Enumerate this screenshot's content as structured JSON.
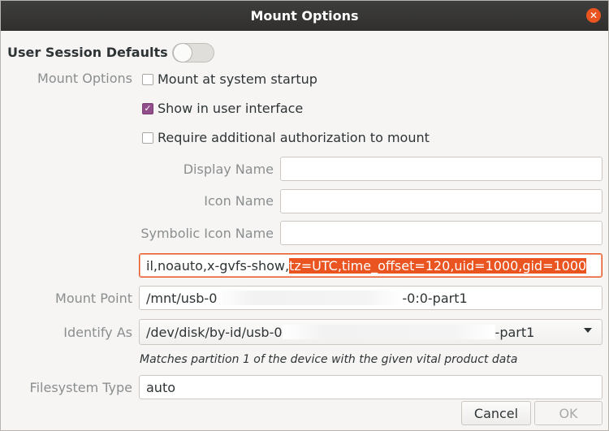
{
  "window": {
    "title": "Mount Options",
    "close_icon": "close-icon"
  },
  "section": {
    "title": "User Session Defaults",
    "toggle_on": false
  },
  "mount_options": {
    "label": "Mount Options",
    "checkboxes": [
      {
        "label": "Mount at system startup",
        "checked": false
      },
      {
        "label": "Show in user interface",
        "checked": true
      },
      {
        "label": "Require additional authorization to mount",
        "checked": false
      }
    ]
  },
  "fields": {
    "display_name": {
      "label": "Display Name",
      "value": ""
    },
    "icon_name": {
      "label": "Icon Name",
      "value": ""
    },
    "symbolic_icon_name": {
      "label": "Symbolic Icon Name",
      "value": ""
    },
    "options_line": {
      "value_plain": "il,noauto,x-gvfs-show,",
      "value_selected": "tz=UTC,time_offset=120,uid=1000,gid=1000"
    },
    "mount_point": {
      "label": "Mount Point",
      "value_start": "/mnt/usb-0",
      "value_end": "-0:0-part1"
    },
    "identify_as": {
      "label": "Identify As",
      "value_start": "/dev/disk/by-id/usb-0",
      "value_end": "-part1",
      "hint": "Matches partition 1 of the device with the given vital product data"
    },
    "filesystem_type": {
      "label": "Filesystem Type",
      "value": "auto"
    }
  },
  "buttons": {
    "cancel": "Cancel",
    "ok": "OK"
  },
  "colors": {
    "accent": "#e95420",
    "check": "#924d8b",
    "titlebar": "#302f2d"
  }
}
